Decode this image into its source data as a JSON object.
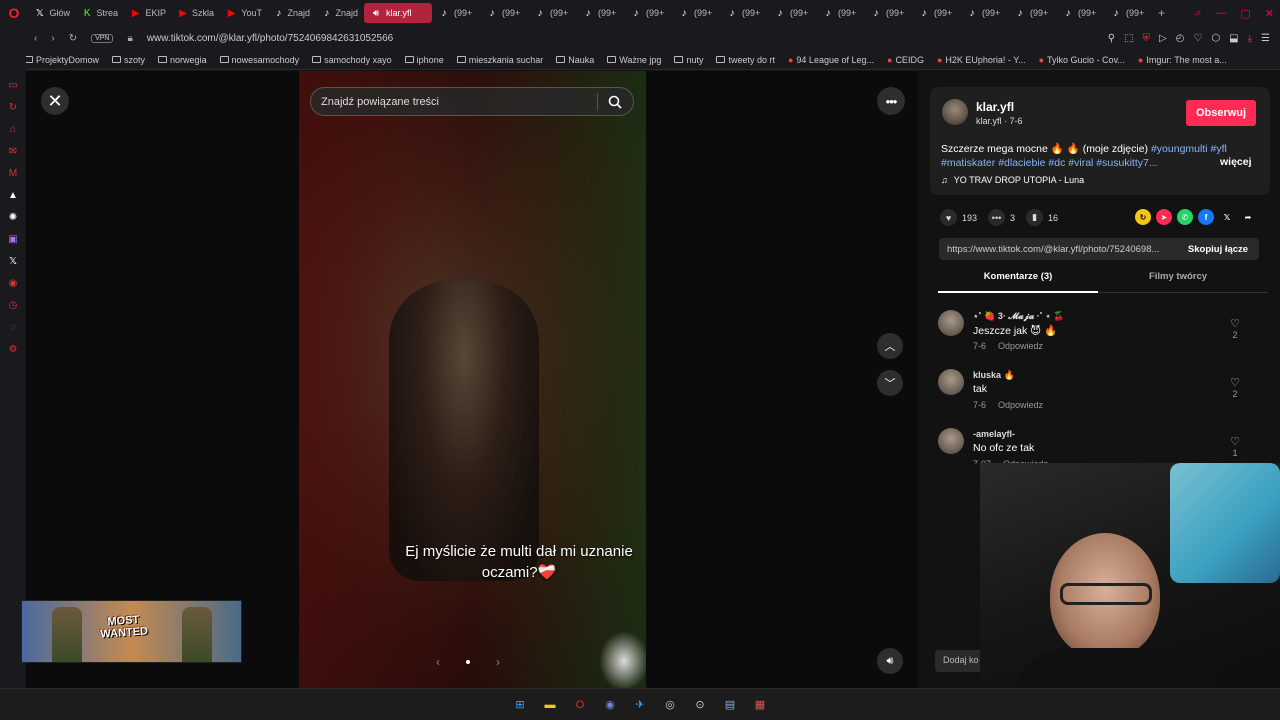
{
  "browser": {
    "tabs": [
      {
        "label": "Głów",
        "icon": "x-icon"
      },
      {
        "label": "Strea",
        "icon": "kick-icon"
      },
      {
        "label": "EKIP",
        "icon": "youtube-icon"
      },
      {
        "label": "Szkla",
        "icon": "youtube-icon"
      },
      {
        "label": "YouT",
        "icon": "youtube-icon"
      },
      {
        "label": "Znajd",
        "icon": "tiktok-icon"
      },
      {
        "label": "Znajd",
        "icon": "tiktok-icon"
      },
      {
        "label": "klar.yfl",
        "icon": "speaker-icon",
        "active": true
      },
      {
        "label": "(99+",
        "icon": "tiktok-icon"
      },
      {
        "label": "(99+",
        "icon": "tiktok-icon"
      },
      {
        "label": "(99+",
        "icon": "tiktok-icon"
      },
      {
        "label": "(99+",
        "icon": "tiktok-icon"
      },
      {
        "label": "(99+",
        "icon": "tiktok-icon"
      },
      {
        "label": "(99+",
        "icon": "tiktok-icon"
      },
      {
        "label": "(99+",
        "icon": "tiktok-icon"
      },
      {
        "label": "(99+",
        "icon": "tiktok-icon"
      },
      {
        "label": "(99+",
        "icon": "tiktok-icon"
      },
      {
        "label": "(99+",
        "icon": "tiktok-icon"
      },
      {
        "label": "(99+",
        "icon": "tiktok-icon"
      },
      {
        "label": "(99+",
        "icon": "tiktok-icon"
      },
      {
        "label": "(99+",
        "icon": "tiktok-icon"
      },
      {
        "label": "(99+",
        "icon": "tiktok-icon"
      },
      {
        "label": "(99+",
        "icon": "tiktok-icon"
      }
    ],
    "vpn_label": "VPN",
    "url": "www.tiktok.com/@klar.yfl/photo/7524069842631052566",
    "bookmarks": [
      {
        "label": "ProjektyDomow",
        "type": "folder"
      },
      {
        "label": "szoty",
        "type": "folder"
      },
      {
        "label": "norwegia",
        "type": "folder"
      },
      {
        "label": "nowesamochody",
        "type": "folder"
      },
      {
        "label": "samochody xayo",
        "type": "folder"
      },
      {
        "label": "iphone",
        "type": "folder"
      },
      {
        "label": "mieszkania suchar",
        "type": "folder"
      },
      {
        "label": "Nauka",
        "type": "folder"
      },
      {
        "label": "Ważne jpg",
        "type": "folder"
      },
      {
        "label": "nuty",
        "type": "folder"
      },
      {
        "label": "tweety do rt",
        "type": "folder"
      },
      {
        "label": "94 League of Leg...",
        "type": "site"
      },
      {
        "label": "CEIDG",
        "type": "site"
      },
      {
        "label": "H2K EUphoria! - Y...",
        "type": "site"
      },
      {
        "label": "Tylko Gucio - Cov...",
        "type": "site"
      },
      {
        "label": "Imgur: The most a...",
        "type": "site"
      }
    ]
  },
  "viewer": {
    "search_placeholder": "Znajdź powiązane treści",
    "caption": "Ej myślicie że multi dał mi uznanie oczami?❤️‍🩹"
  },
  "ad": {
    "title_line1": "MOST",
    "title_line2": "WANTED"
  },
  "post": {
    "author_name": "klar.yfl",
    "author_handle": "klar.yfl",
    "author_date": "7-6",
    "follow_label": "Obserwuj",
    "description_text": "Szczerze mega mocne 🔥 🔥 (moje zdjęcie) ",
    "description_tags": [
      "#youngmulti",
      "#yfl",
      "#matiskater",
      "#dlaciebie",
      "#dc",
      "#viral",
      "#susukitty7..."
    ],
    "more_label": "więcej",
    "music": "YO TRAV DROP UTOPIA - Luna",
    "likes": "193",
    "comments_count": "3",
    "saves": "16",
    "link": "https://www.tiktok.com/@klar.yfl/photo/75240698...",
    "copy_label": "Skopiuj łącze",
    "tab_comments": "Komentarze (3)",
    "tab_creator": "Filmy twórcy",
    "comment_placeholder": "Dodaj ko"
  },
  "comments": [
    {
      "name": "⋆˚ 🍓 3· 𝓜𝓪𝓳𝓪 ·˚ ⋆ 🍒",
      "text": "Jeszcze jak 😈 🔥",
      "date": "7-6",
      "reply": "Odpowiedz",
      "likes": "2"
    },
    {
      "name": "kluska 🔥",
      "text": "tak",
      "date": "7-6",
      "reply": "Odpowiedz",
      "likes": "2"
    },
    {
      "name": "-amelayfl-",
      "text": "No ofc ze tak",
      "date": "7-07",
      "reply": "Odpowiedz",
      "likes": "1"
    }
  ],
  "colors": {
    "accent": "#fe2c55",
    "tab_active": "#b2243d",
    "opera_red": "#ff1b2d",
    "hashtag": "#8ab4f8"
  }
}
